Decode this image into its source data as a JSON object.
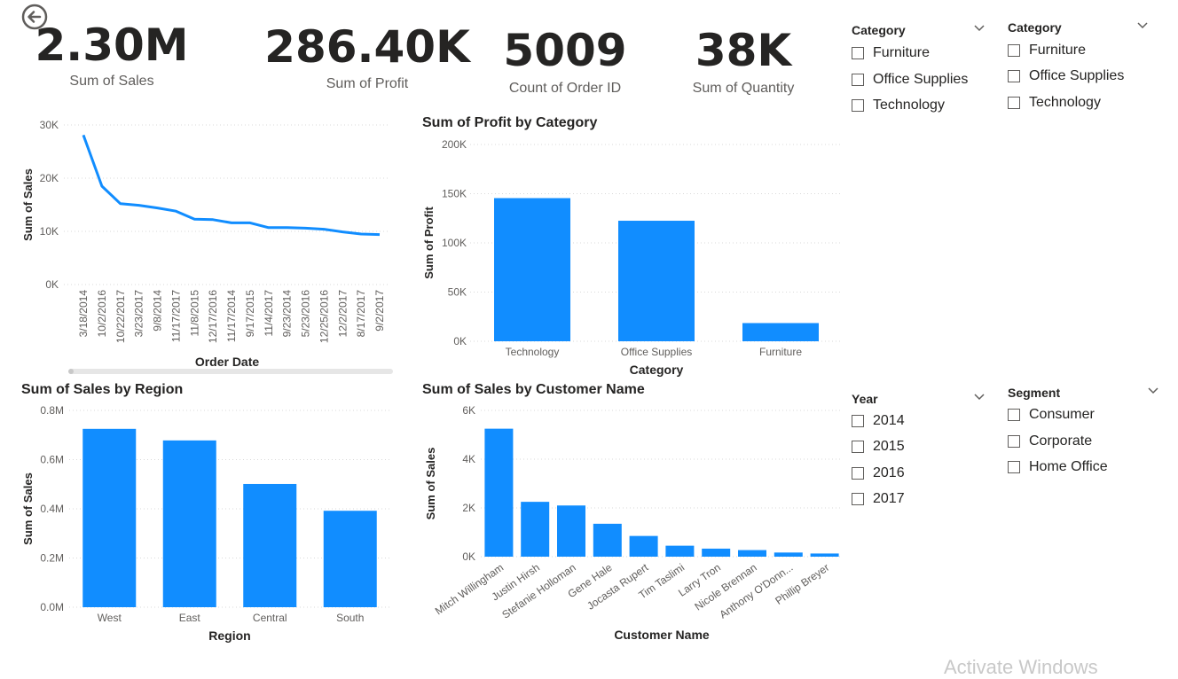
{
  "colors": {
    "bar": "#118DFF",
    "text": "#252423",
    "muted": "#605e5c",
    "grid": "#d9d9d9"
  },
  "back_icon": "arrow-left-circle-icon",
  "kpis": [
    {
      "value": "2.30M",
      "label": "Sum of Sales"
    },
    {
      "value": "286.40K",
      "label": "Sum of Profit"
    },
    {
      "value": "5009",
      "label": "Count of Order ID"
    },
    {
      "value": "38K",
      "label": "Sum of Quantity"
    }
  ],
  "slicers": {
    "category1": {
      "title": "Category",
      "options": [
        "Furniture",
        "Office Supplies",
        "Technology"
      ]
    },
    "category2": {
      "title": "Category",
      "options": [
        "Furniture",
        "Office Supplies",
        "Technology"
      ]
    },
    "year": {
      "title": "Year",
      "options": [
        "2014",
        "2015",
        "2016",
        "2017"
      ]
    },
    "segment": {
      "title": "Segment",
      "options": [
        "Consumer",
        "Corporate",
        "Home Office"
      ]
    }
  },
  "watermark": "Activate Windows",
  "chart_data": [
    {
      "id": "line",
      "type": "line",
      "title": "",
      "xlabel": "Order Date",
      "ylabel": "Sum of Sales",
      "ylim": [
        0,
        30000
      ],
      "yticks": [
        "0K",
        "10K",
        "20K",
        "30K"
      ],
      "grid": true,
      "x": [
        "3/18/2014",
        "10/2/2016",
        "10/22/2017",
        "3/23/2017",
        "9/8/2014",
        "11/17/2017",
        "11/8/2015",
        "12/17/2016",
        "11/17/2014",
        "9/17/2015",
        "11/4/2017",
        "9/23/2014",
        "5/23/2016",
        "12/25/2016",
        "12/2/2017",
        "8/17/2017",
        "9/2/2017"
      ],
      "values": [
        28100,
        18500,
        15200,
        14900,
        14400,
        13800,
        12300,
        12200,
        11600,
        11600,
        10700,
        10700,
        10600,
        10400,
        9900,
        9500,
        9400
      ]
    },
    {
      "id": "profit",
      "type": "bar",
      "title": "Sum of Profit by Category",
      "xlabel": "Category",
      "ylabel": "Sum of Profit",
      "ylim": [
        0,
        200000
      ],
      "yticks": [
        "0K",
        "50K",
        "100K",
        "150K",
        "200K"
      ],
      "grid": true,
      "categories": [
        "Technology",
        "Office Supplies",
        "Furniture"
      ],
      "values": [
        145500,
        122500,
        18500
      ]
    },
    {
      "id": "region",
      "type": "bar",
      "title": "Sum of Sales by Region",
      "xlabel": "Region",
      "ylabel": "Sum of Sales",
      "ylim": [
        0,
        800000
      ],
      "yticks": [
        "0.0M",
        "0.2M",
        "0.4M",
        "0.6M",
        "0.8M"
      ],
      "grid": true,
      "categories": [
        "West",
        "East",
        "Central",
        "South"
      ],
      "values": [
        725000,
        678000,
        501000,
        392000
      ]
    },
    {
      "id": "customer",
      "type": "bar",
      "title": "Sum of Sales by Customer Name",
      "xlabel": "Customer Name",
      "ylabel": "Sum of Sales",
      "ylim": [
        0,
        6000
      ],
      "yticks": [
        "0K",
        "2K",
        "4K",
        "6K"
      ],
      "grid": true,
      "categories": [
        "Mitch Willingham",
        "Justin Hirsh",
        "Stefanie Holloman",
        "Gene Hale",
        "Jocasta Rupert",
        "Tim Taslimi",
        "Larry Tron",
        "Nicole Brennan",
        "Anthony O'Donn...",
        "Phillip Breyer"
      ],
      "values": [
        5250,
        2250,
        2100,
        1350,
        850,
        450,
        330,
        270,
        170,
        130
      ]
    }
  ]
}
